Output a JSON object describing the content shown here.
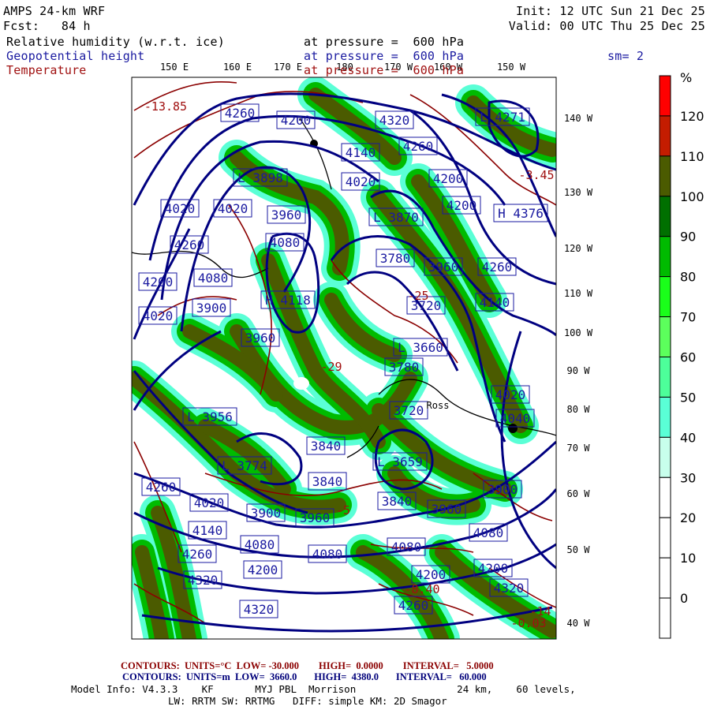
{
  "header": {
    "model": "AMPS 24-km WRF",
    "forecast": "Fcst:   84 h",
    "init": "Init: 12 UTC Sun 21 Dec 25",
    "valid": "Valid: 00 UTC Thu 25 Dec 25",
    "fields": [
      {
        "name": "Relative humidity (w.r.t. ice)",
        "level": "at pressure =  600 hPa",
        "color": "#000000"
      },
      {
        "name": "Geopotential height",
        "level": "at pressure =  600 hPa",
        "color": "#1a1aa0"
      },
      {
        "name": "Temperature",
        "level": "at pressure =  600 hPa",
        "color": "#a01010"
      }
    ],
    "smoothing": "sm= 2"
  },
  "map": {
    "top_lon_labels": [
      "150 E",
      "160 E",
      "170 E",
      "180",
      "170 W",
      "160 W",
      "150 W"
    ],
    "right_lon_labels": [
      "140 W",
      "130 W",
      "120 W",
      "110 W",
      "100 W",
      "90 W",
      "80 W",
      "70 W",
      "60 W",
      "50 W",
      "40 W"
    ],
    "height_labels": [
      "4260",
      "4200",
      "L 3898",
      "4020",
      "4020",
      "3960",
      "4260",
      "4080",
      "4200",
      "4080",
      "4020",
      "3900",
      "H 4118",
      "3960",
      "4320",
      "4260",
      "4140",
      "4020",
      "L 4271",
      "4200",
      "4200",
      "H 4376",
      "L 3870",
      "3780",
      "3960",
      "4260",
      "3720",
      "4140",
      "L 3660",
      "L 3956",
      "L 3774",
      "3840",
      "3840",
      "4260",
      "4020",
      "3900",
      "3960",
      "4140",
      "4080",
      "4080",
      "4260",
      "4200",
      "4320",
      "4320",
      "3780",
      "4020",
      "3720",
      "4040",
      "L 3659",
      "3900",
      "3840",
      "3960",
      "4080",
      "4080",
      "4200",
      "4200",
      "4320",
      "4260"
    ],
    "temperature_labels": [
      "-3.45",
      "-13.85",
      "-8.40",
      "-29",
      "-25",
      "-14",
      "-5",
      "-0.03"
    ],
    "place_label": "Ross"
  },
  "colorbar": {
    "unit": "%",
    "labels": [
      "120",
      "110",
      "100",
      "90",
      "80",
      "70",
      "60",
      "50",
      "40",
      "30",
      "20",
      "10",
      "0"
    ],
    "colors": [
      "#ff0000",
      "#c41c00",
      "#4b5b00",
      "#007000",
      "#00bb00",
      "#1aff1a",
      "#5cff5c",
      "#4dff9a",
      "#5affd6",
      "#c8ffec",
      "#ffffff",
      "#ffffff",
      "#ffffff",
      "#ffffff"
    ]
  },
  "footer": {
    "temp_contours": {
      "label": "CONTOURS:",
      "units": "UNITS=°C",
      "low": "LOW= -30.000",
      "high": "HIGH=  0.0000",
      "interval": "INTERVAL=   5.0000"
    },
    "height_contours": {
      "label": "CONTOURS:",
      "units": "UNITS=m",
      "low": "LOW=  3660.0",
      "high": "HIGH=  4380.0",
      "interval": "INTERVAL=   60.000"
    },
    "model_info_1": "Model Info: V4.3.3    KF       MYJ PBL  Morrison                 24 km,    60 levels,",
    "model_info_2": "LW: RRTM SW: RRTMG   DIFF: simple KM: 2D Smagor"
  }
}
